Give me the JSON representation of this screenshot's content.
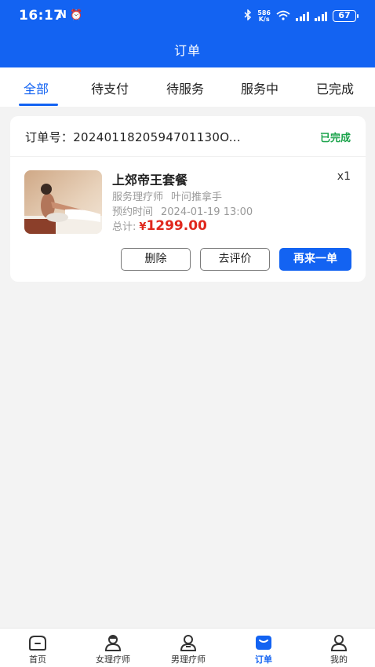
{
  "status_bar": {
    "time": "16:17",
    "left_icons": "N ⏰",
    "speed_top": "586",
    "speed_bottom": "K/s",
    "battery": "67",
    "icons": [
      "bluetooth-icon",
      "wifi-icon",
      "signal-icon",
      "signal-icon"
    ]
  },
  "header": {
    "title": "订单"
  },
  "tabs": [
    {
      "label": "全部",
      "active": true
    },
    {
      "label": "待支付",
      "active": false
    },
    {
      "label": "待服务",
      "active": false
    },
    {
      "label": "服务中",
      "active": false
    },
    {
      "label": "已完成",
      "active": false
    }
  ],
  "order": {
    "order_no_label": "订单号：",
    "order_no": "2024011820594701130O...",
    "status": "已完成",
    "product_name": "上郊帝王套餐",
    "quantity": "x1",
    "therapist_label": "服务理疗师",
    "therapist": "叶问推拿手",
    "time_label": "预约时间",
    "time": "2024-01-19 13:00",
    "total_label": "总计:",
    "currency": "¥",
    "total": "1299.00",
    "buttons": {
      "delete": "删除",
      "review": "去评价",
      "reorder": "再来一单"
    }
  },
  "bottom_nav": [
    {
      "label": "首页",
      "icon": "home-icon",
      "active": false
    },
    {
      "label": "女理疗师",
      "icon": "female-therapist-icon",
      "active": false
    },
    {
      "label": "男理疗师",
      "icon": "male-therapist-icon",
      "active": false
    },
    {
      "label": "订单",
      "icon": "order-icon",
      "active": true
    },
    {
      "label": "我的",
      "icon": "profile-icon",
      "active": false
    }
  ],
  "colors": {
    "primary": "#1363f2",
    "success": "#1aa34a",
    "price": "#e0281d"
  }
}
